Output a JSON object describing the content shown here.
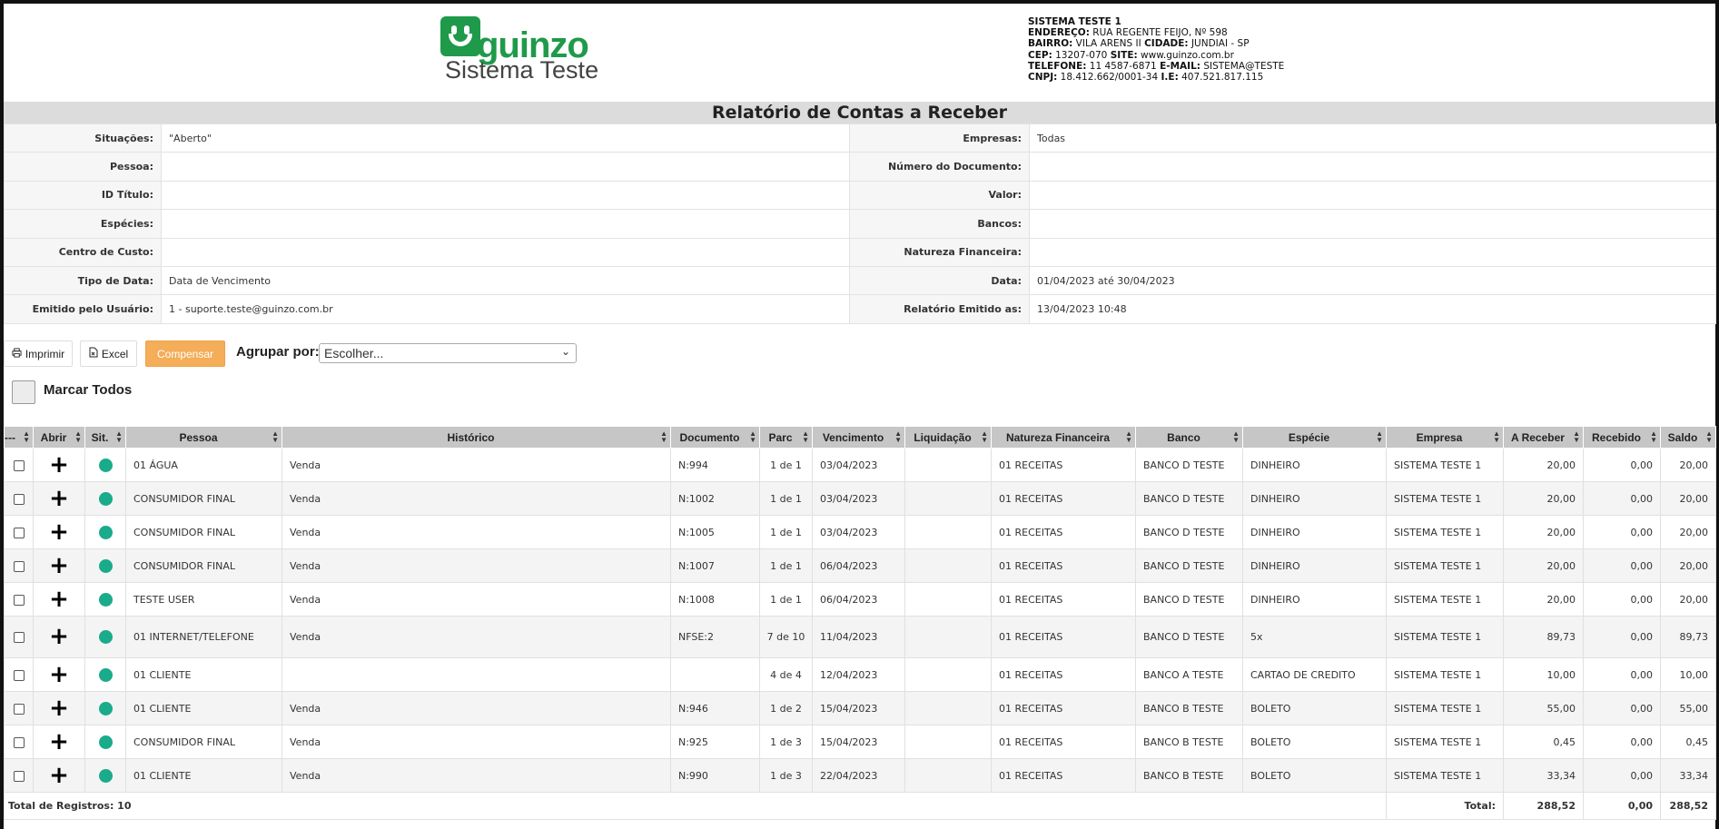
{
  "logo": {
    "wordmark": "guinzo",
    "subtitle": "Sistema Teste",
    "brand_color": "#1f9a4a"
  },
  "company": {
    "name": "SISTEMA TESTE 1",
    "lines": [
      [
        {
          "label": "ENDEREÇO:",
          "value": " RUA REGENTE FEIJO, Nº 598"
        }
      ],
      [
        {
          "label": "BAIRRO:",
          "value": " VILA ARENS II "
        },
        {
          "label": "CIDADE:",
          "value": " JUNDIAI - SP"
        }
      ],
      [
        {
          "label": "CEP:",
          "value": " 13207-070 "
        },
        {
          "label": "SITE:",
          "value": " www.guinzo.com.br"
        }
      ],
      [
        {
          "label": "TELEFONE:",
          "value": " 11 4587-6871 "
        },
        {
          "label": "E-MAIL:",
          "value": " SISTEMA@TESTE"
        }
      ],
      [
        {
          "label": "CNPJ:",
          "value": " 18.412.662/0001-34 "
        },
        {
          "label": "I.E:",
          "value": " 407.521.817.115"
        }
      ]
    ]
  },
  "report_title": "Relatório de Contas a Receber",
  "filters": [
    {
      "l1": "Situações:",
      "v1": "\"Aberto\"",
      "l2": "Empresas:",
      "v2": "Todas"
    },
    {
      "l1": "Pessoa:",
      "v1": "",
      "l2": "Número do Documento:",
      "v2": ""
    },
    {
      "l1": "ID Título:",
      "v1": "",
      "l2": "Valor:",
      "v2": ""
    },
    {
      "l1": "Espécies:",
      "v1": "",
      "l2": "Bancos:",
      "v2": ""
    },
    {
      "l1": "Centro de Custo:",
      "v1": "",
      "l2": "Natureza Financeira:",
      "v2": ""
    },
    {
      "l1": "Tipo de Data:",
      "v1": "Data de Vencimento",
      "l2": "Data:",
      "v2": "01/04/2023 até 30/04/2023"
    },
    {
      "l1": "Emitido pelo Usuário:",
      "v1": "1 - suporte.teste@guinzo.com.br",
      "l2": "Relatório Emitido as:",
      "v2": "13/04/2023 10:48"
    }
  ],
  "toolbar": {
    "print_label": "Imprimir",
    "excel_label": "Excel",
    "compensate_label": "Compensar",
    "group_label": "Agrupar por:",
    "group_selected": "Escolher...",
    "mark_all_label": "Marcar Todos"
  },
  "table": {
    "headers": [
      "---",
      "Abrir",
      "Sit.",
      "Pessoa",
      "Histórico",
      "Documento",
      "Parc",
      "Vencimento",
      "Liquidação",
      "Natureza Financeira",
      "Banco",
      "Espécie",
      "Empresa",
      "A Receber",
      "Recebido",
      "Saldo"
    ],
    "status_color": "#1aab8a",
    "rows": [
      {
        "pessoa": "01 ÁGUA",
        "historico": "Venda",
        "documento": "N:994",
        "parc": "1 de 1",
        "vencimento": "03/04/2023",
        "liquidacao": "",
        "natureza": "01 RECEITAS",
        "banco": "BANCO D TESTE",
        "especie": "DINHEIRO",
        "empresa": "SISTEMA TESTE 1",
        "a_receber": "20,00",
        "recebido": "0,00",
        "saldo": "20,00"
      },
      {
        "pessoa": "CONSUMIDOR FINAL",
        "historico": "Venda",
        "documento": "N:1002",
        "parc": "1 de 1",
        "vencimento": "03/04/2023",
        "liquidacao": "",
        "natureza": "01 RECEITAS",
        "banco": "BANCO D TESTE",
        "especie": "DINHEIRO",
        "empresa": "SISTEMA TESTE 1",
        "a_receber": "20,00",
        "recebido": "0,00",
        "saldo": "20,00"
      },
      {
        "pessoa": "CONSUMIDOR FINAL",
        "historico": "Venda",
        "documento": "N:1005",
        "parc": "1 de 1",
        "vencimento": "03/04/2023",
        "liquidacao": "",
        "natureza": "01 RECEITAS",
        "banco": "BANCO D TESTE",
        "especie": "DINHEIRO",
        "empresa": "SISTEMA TESTE 1",
        "a_receber": "20,00",
        "recebido": "0,00",
        "saldo": "20,00"
      },
      {
        "pessoa": "CONSUMIDOR FINAL",
        "historico": "Venda",
        "documento": "N:1007",
        "parc": "1 de 1",
        "vencimento": "06/04/2023",
        "liquidacao": "",
        "natureza": "01 RECEITAS",
        "banco": "BANCO D TESTE",
        "especie": "DINHEIRO",
        "empresa": "SISTEMA TESTE 1",
        "a_receber": "20,00",
        "recebido": "0,00",
        "saldo": "20,00"
      },
      {
        "pessoa": "TESTE USER",
        "historico": "Venda",
        "documento": "N:1008",
        "parc": "1 de 1",
        "vencimento": "06/04/2023",
        "liquidacao": "",
        "natureza": "01 RECEITAS",
        "banco": "BANCO D TESTE",
        "especie": "DINHEIRO",
        "empresa": "SISTEMA TESTE 1",
        "a_receber": "20,00",
        "recebido": "0,00",
        "saldo": "20,00"
      },
      {
        "pessoa": "01 INTERNET/TELEFONE",
        "historico": "Venda",
        "documento": "NFSE:2",
        "parc": "7 de 10",
        "vencimento": "11/04/2023",
        "liquidacao": "",
        "natureza": "01 RECEITAS",
        "banco": "BANCO D TESTE",
        "especie": "5x",
        "empresa": "SISTEMA TESTE 1",
        "a_receber": "89,73",
        "recebido": "0,00",
        "saldo": "89,73"
      },
      {
        "pessoa": "01 CLIENTE",
        "historico": "",
        "documento": "",
        "parc": "4 de 4",
        "vencimento": "12/04/2023",
        "liquidacao": "",
        "natureza": "01 RECEITAS",
        "banco": "BANCO A TESTE",
        "especie": "CARTAO DE CREDITO",
        "empresa": "SISTEMA TESTE 1",
        "a_receber": "10,00",
        "recebido": "0,00",
        "saldo": "10,00"
      },
      {
        "pessoa": "01 CLIENTE",
        "historico": "Venda",
        "documento": "N:946",
        "parc": "1 de 2",
        "vencimento": "15/04/2023",
        "liquidacao": "",
        "natureza": "01 RECEITAS",
        "banco": "BANCO B TESTE",
        "especie": "BOLETO",
        "empresa": "SISTEMA TESTE 1",
        "a_receber": "55,00",
        "recebido": "0,00",
        "saldo": "55,00"
      },
      {
        "pessoa": "CONSUMIDOR FINAL",
        "historico": "Venda",
        "documento": "N:925",
        "parc": "1 de 3",
        "vencimento": "15/04/2023",
        "liquidacao": "",
        "natureza": "01 RECEITAS",
        "banco": "BANCO B TESTE",
        "especie": "BOLETO",
        "empresa": "SISTEMA TESTE 1",
        "a_receber": "0,45",
        "recebido": "0,00",
        "saldo": "0,45"
      },
      {
        "pessoa": "01 CLIENTE",
        "historico": "Venda",
        "documento": "N:990",
        "parc": "1 de 3",
        "vencimento": "22/04/2023",
        "liquidacao": "",
        "natureza": "01 RECEITAS",
        "banco": "BANCO B TESTE",
        "especie": "BOLETO",
        "empresa": "SISTEMA TESTE 1",
        "a_receber": "33,34",
        "recebido": "0,00",
        "saldo": "33,34"
      }
    ],
    "footer": {
      "count_label": "Total de Registros: 10",
      "total_label": "Total:",
      "a_receber": "288,52",
      "recebido": "0,00",
      "saldo": "288,52"
    }
  }
}
